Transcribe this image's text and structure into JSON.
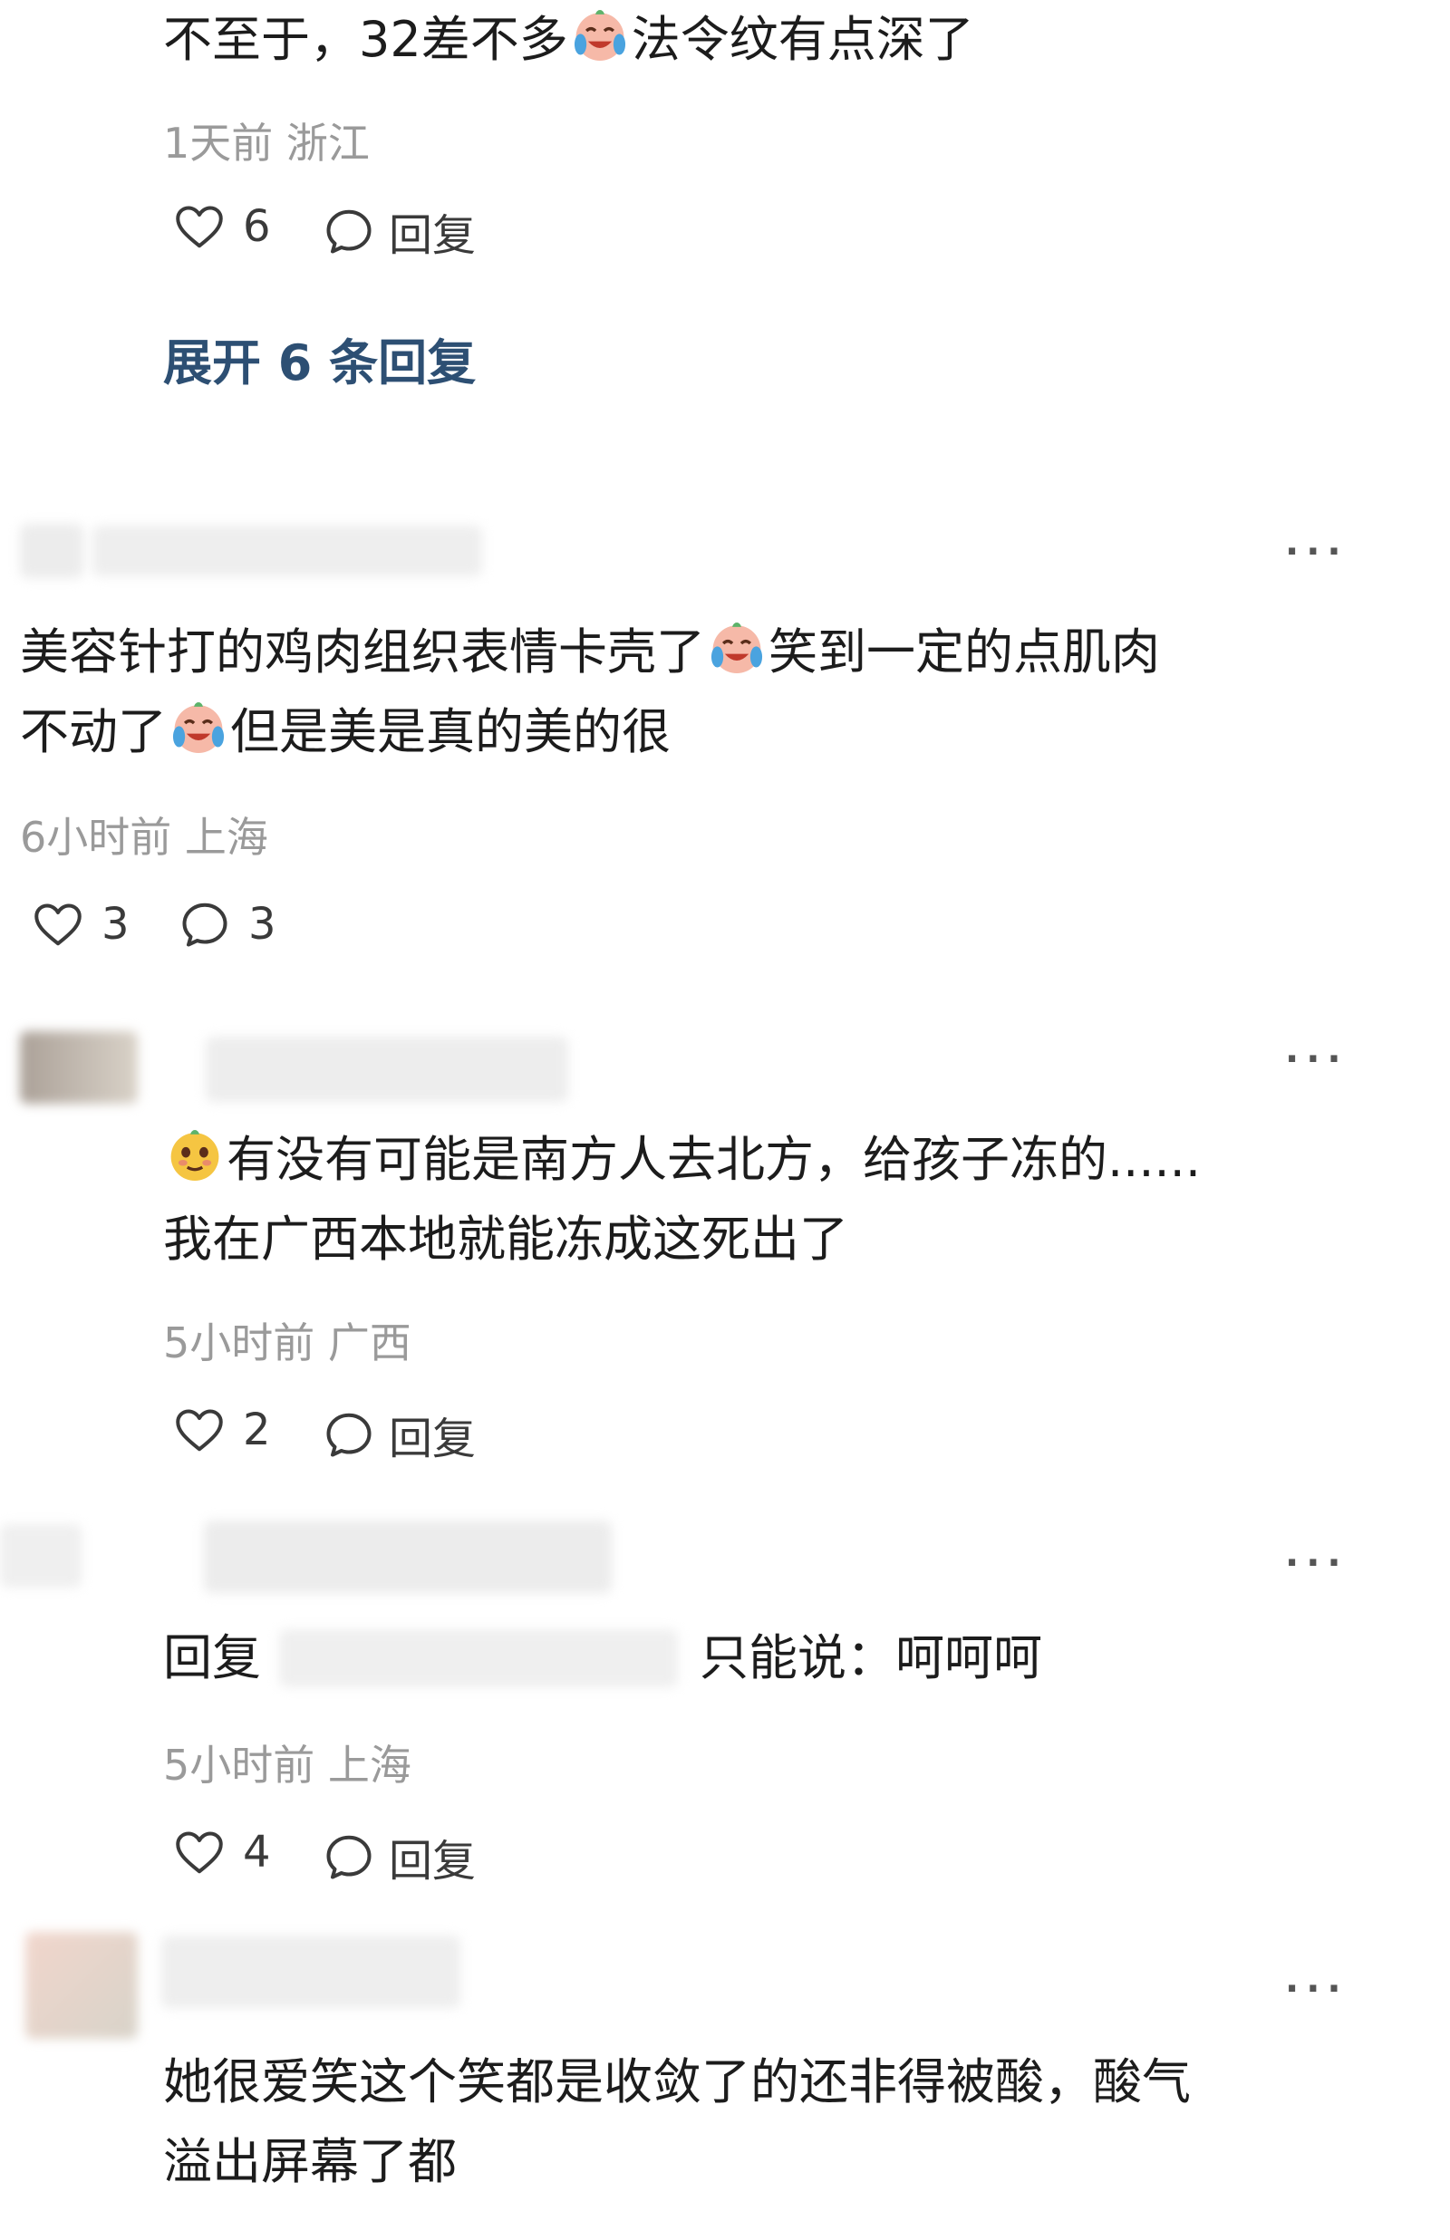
{
  "comments": [
    {
      "text_a": "不至于，32差不多",
      "emoji_a": "crying-laughing-icon",
      "text_b": "法令纹有点深了",
      "meta": "1天前 浙江",
      "likes": "6",
      "reply": "回复",
      "expand": "展开 6 条回复"
    },
    {
      "line1_a": "美容针打的鸡肉组织表情卡壳了",
      "emoji_1": "crying-laughing-icon",
      "line1_b": "笑到一定的点肌肉",
      "line2_a": "不动了",
      "emoji_2": "crying-laughing-icon",
      "line2_b": "但是美是真的美的很",
      "meta": "6小时前 上海",
      "likes": "3",
      "replies": "3"
    },
    {
      "emoji_1": "smirk-face-icon",
      "line1": "有没有可能是南方人去北方，给孩子冻的......",
      "line2": "我在广西本地就能冻成这死出了",
      "meta": "5小时前 广西",
      "likes": "2",
      "reply": "回复"
    },
    {
      "reply_prefix": "回复",
      "text": "只能说：呵呵呵",
      "meta": "5小时前 上海",
      "likes": "4",
      "reply": "回复"
    },
    {
      "line1": "她很爱笑这个笑都是收敛了的还非得被酸，酸气",
      "line2": "溢出屏幕了都"
    }
  ],
  "more_label": "···",
  "colors": {
    "link": "#2d4f73",
    "meta": "#9a9a9a",
    "text": "#1c1c1c"
  }
}
